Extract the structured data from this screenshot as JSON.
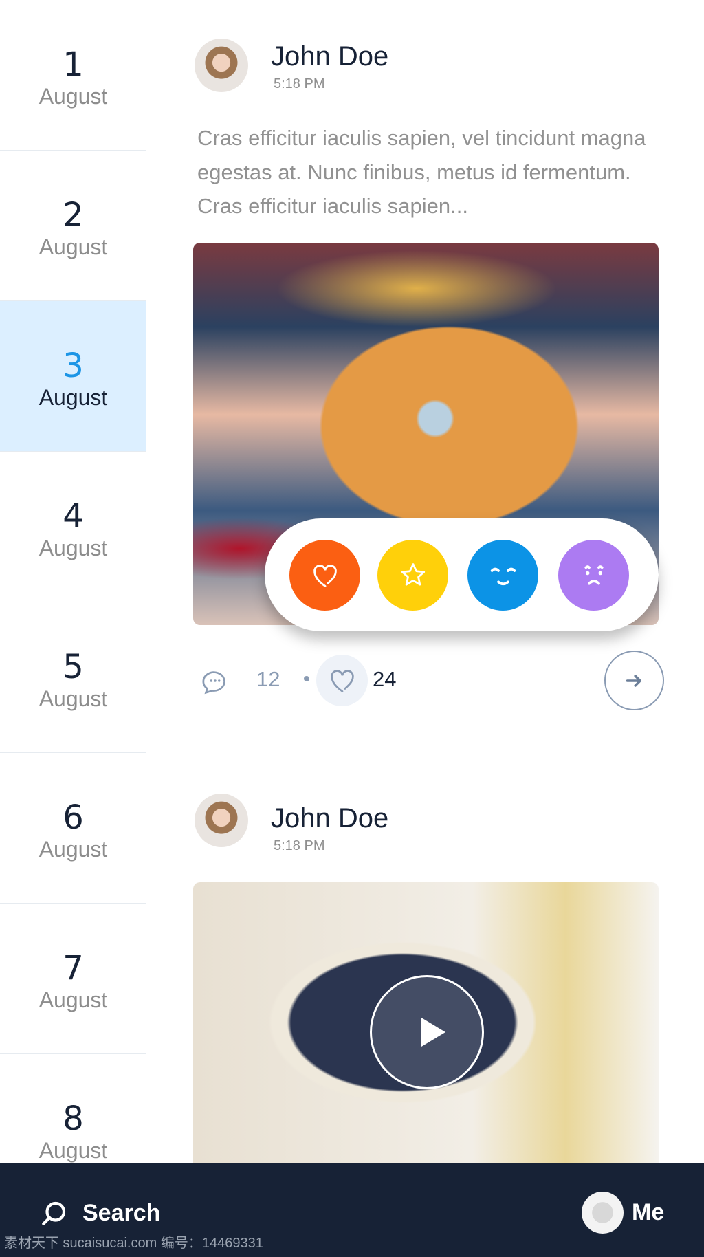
{
  "sidebar": {
    "days": [
      {
        "num": "1",
        "month": "August"
      },
      {
        "num": "2",
        "month": "August"
      },
      {
        "num": "3",
        "month": "August",
        "active": true
      },
      {
        "num": "4",
        "month": "August"
      },
      {
        "num": "5",
        "month": "August"
      },
      {
        "num": "6",
        "month": "August"
      },
      {
        "num": "7",
        "month": "August"
      },
      {
        "num": "8",
        "month": "August"
      }
    ]
  },
  "posts": [
    {
      "author": "John Doe",
      "time": "5:18 PM",
      "text": "Cras efficitur iaculis sapien, vel tincidunt magna egestas at. Nunc finibus, metus id fermentum. Cras efficitur iaculis sapien...",
      "comments": "12",
      "likes": "24",
      "reactions": [
        {
          "icon": "heart-icon",
          "color": "#fb5f12"
        },
        {
          "icon": "star-icon",
          "color": "#ffd00a"
        },
        {
          "icon": "smile-icon",
          "color": "#0c93e6"
        },
        {
          "icon": "sad-icon",
          "color": "#ac7bf2"
        }
      ]
    },
    {
      "author": "John Doe",
      "time": "5:18 PM"
    }
  ],
  "bottom_bar": {
    "search_label": "Search",
    "me_label": "Me"
  },
  "watermark": "素材天下 sucaisucai.com  编号：14469331",
  "colors": {
    "accent": "#1c95e6",
    "active_bg": "#dcefff",
    "bar": "#172236"
  }
}
